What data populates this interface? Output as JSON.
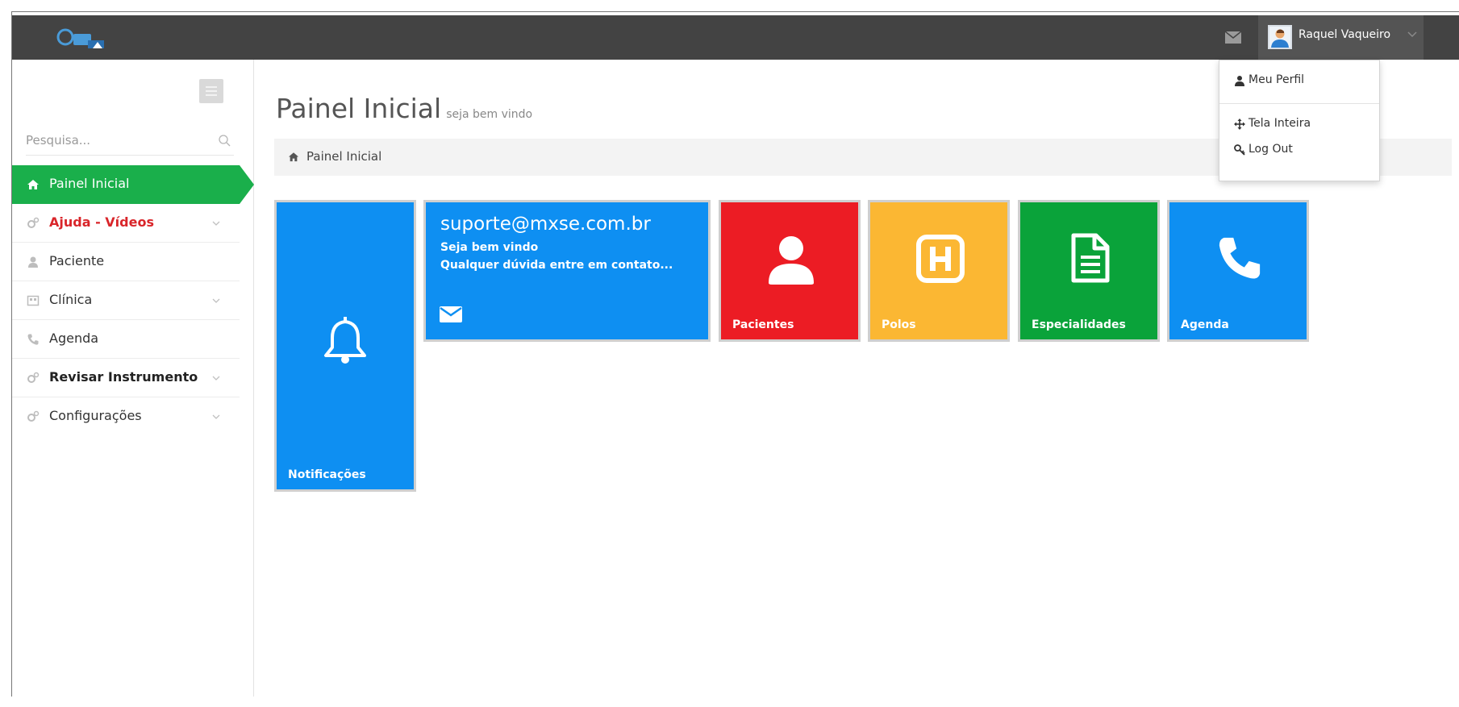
{
  "app": {
    "colors": {
      "topbar": "#434343",
      "accent_green": "#1aaf4b",
      "tile_blue": "#0e8ff2",
      "tile_red": "#ec1c24",
      "tile_yellow": "#fbb733",
      "tile_green": "#0aa33a",
      "highlight_red": "#d9252a"
    }
  },
  "topbar": {
    "logo_icon": "app-logo-icon",
    "mail_icon": "envelope-icon",
    "user": {
      "name": "Raquel Vaqueiro",
      "avatar_icon": "user-avatar-icon",
      "caret_icon": "chevron-down-icon"
    }
  },
  "user_menu": {
    "items": [
      {
        "label": "Meu Perfil",
        "icon": "user-icon"
      },
      {
        "label": "Tela Inteira",
        "icon": "arrows-move-icon"
      },
      {
        "label": "Log Out",
        "icon": "key-icon"
      }
    ]
  },
  "sidebar": {
    "toggle_icon": "menu-toggle-icon",
    "search": {
      "placeholder": "Pesquisa...",
      "value": "",
      "icon": "search-icon"
    },
    "items": [
      {
        "label": "Painel Inicial",
        "icon": "home-icon",
        "active": true
      },
      {
        "label": "Ajuda - Vídeos",
        "icon": "gears-icon",
        "has_submenu": true
      },
      {
        "label": "Paciente",
        "icon": "user-icon"
      },
      {
        "label": "Clínica",
        "icon": "building-icon",
        "has_submenu": true
      },
      {
        "label": "Agenda",
        "icon": "phone-icon"
      },
      {
        "label": "Revisar Instrumento",
        "icon": "gears-icon",
        "has_submenu": true
      },
      {
        "label": "Configurações",
        "icon": "gears-icon",
        "has_submenu": true
      }
    ]
  },
  "main": {
    "title": "Painel Inicial",
    "subtitle": "seja bem vindo",
    "breadcrumb": {
      "icon": "home-icon",
      "text": "Painel Inicial"
    },
    "tiles": {
      "notificacoes": {
        "label": "Notificações",
        "icon": "bell-icon"
      },
      "support": {
        "email": "suporte@mxse.com.br",
        "line1": "Seja bem vindo",
        "line2": "Qualquer dúvida entre em contato...",
        "icon": "envelope-icon"
      },
      "pacientes": {
        "label": "Pacientes",
        "icon": "user-icon"
      },
      "polos": {
        "label": "Polos",
        "icon": "hospital-icon"
      },
      "especialidades": {
        "label": "Especialidades",
        "icon": "document-icon"
      },
      "agenda": {
        "label": "Agenda",
        "icon": "phone-icon"
      }
    }
  }
}
